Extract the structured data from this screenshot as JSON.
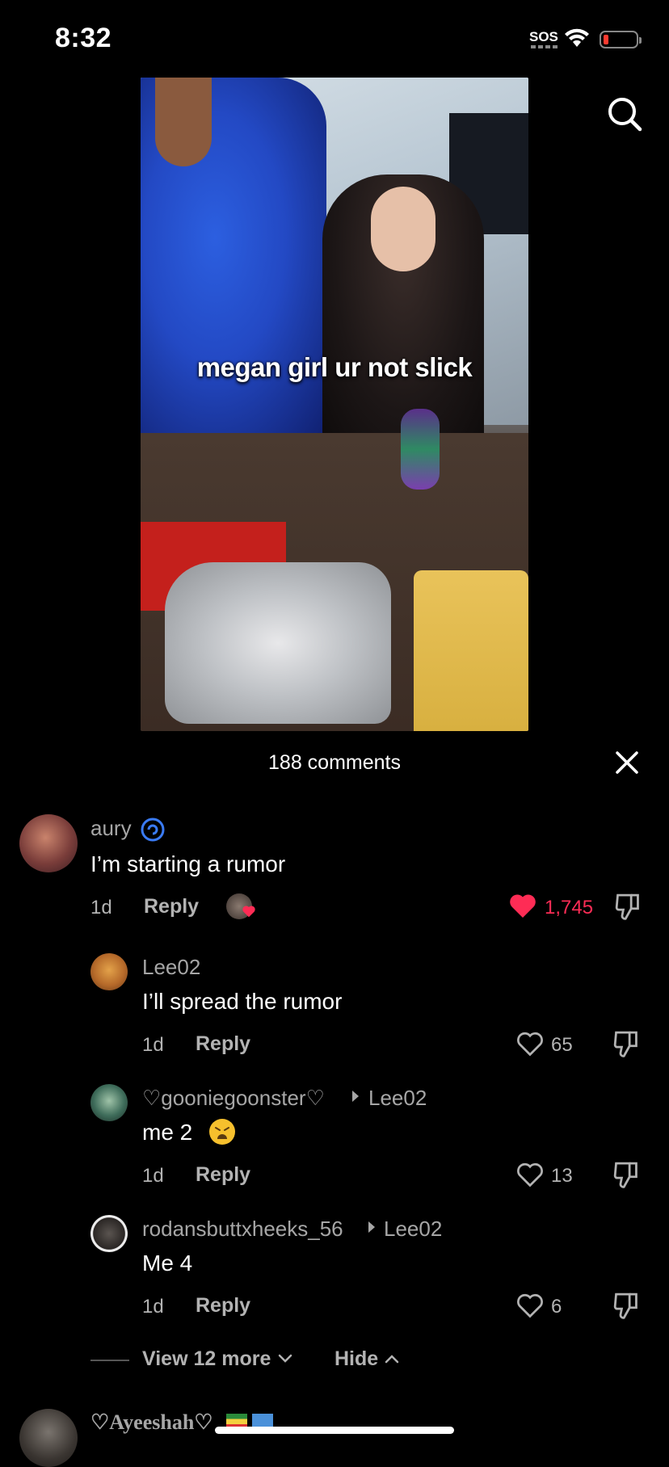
{
  "status_bar": {
    "time": "8:32",
    "sos": "SOS"
  },
  "video": {
    "caption": "megan girl ur not slick"
  },
  "comments_panel": {
    "count_label": "188 comments",
    "comments": [
      {
        "username": "aury",
        "text": "I’m starting a rumor",
        "age": "1d",
        "reply_label": "Reply",
        "likes": "1,745",
        "liked": true
      },
      {
        "username": "Lee02",
        "text": "I’ll spread the rumor",
        "age": "1d",
        "reply_label": "Reply",
        "likes": "65"
      },
      {
        "username": "♡gooniegoonster♡",
        "reply_to": "Lee02",
        "text": "me 2",
        "age": "1d",
        "reply_label": "Reply",
        "likes": "13"
      },
      {
        "username": "rodansbuttxheeks_56",
        "reply_to": "Lee02",
        "text": "Me 4",
        "age": "1d",
        "reply_label": "Reply",
        "likes": "6"
      },
      {
        "username": "♡Ayeeshah♡"
      }
    ],
    "view_more_label": "View 12 more",
    "hide_label": "Hide"
  }
}
